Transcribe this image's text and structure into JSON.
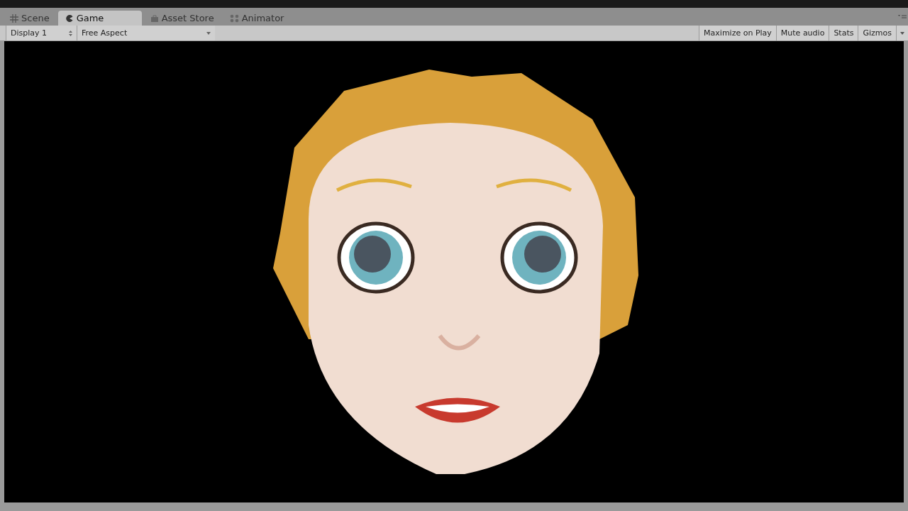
{
  "tabs": [
    {
      "label": "Scene",
      "kind": "scene",
      "selected": false
    },
    {
      "label": "Game",
      "kind": "game",
      "selected": true
    },
    {
      "label": "Asset Store",
      "kind": "store",
      "selected": false
    },
    {
      "label": "Animator",
      "kind": "animator",
      "selected": false
    }
  ],
  "toolbar": {
    "display": "Display 1",
    "aspect": "Free Aspect",
    "buttons": [
      "Maximize on Play",
      "Mute audio",
      "Stats",
      "Gizmos"
    ]
  }
}
